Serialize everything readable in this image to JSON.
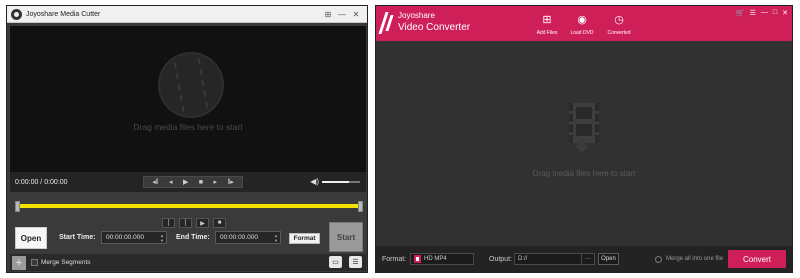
{
  "media_cutter": {
    "title": "Joyoshare Media Cutter",
    "window_controls": [
      "⊞",
      "—",
      "✕"
    ],
    "drag_hint": "Drag media files here to start",
    "time": "0:00:00 / 0:00:00",
    "playback_icons": [
      "◂‖",
      "◂",
      "▶",
      "■",
      "▸",
      "‖▸"
    ],
    "volume_level": 0.7,
    "segment_icons": [
      "[",
      "]",
      "▶",
      "■"
    ],
    "open_label": "Open",
    "start_time_label": "Start Time:",
    "start_time_value": "00:00:00.000",
    "end_time_label": "End Time:",
    "end_time_value": "00:00:00.000",
    "format_label": "Format",
    "start_label": "Start",
    "add_icon": "+",
    "merge_label": "Merge Segments",
    "bottom_icons": [
      "▭",
      "☰"
    ]
  },
  "video_converter": {
    "brand_line1": "Joyoshare",
    "brand_line2": "Video Converter",
    "toolbar": [
      {
        "icon": "⊞",
        "label": "Add Files"
      },
      {
        "icon": "◉",
        "label": "Load DVD"
      },
      {
        "icon": "◷",
        "label": "Converted"
      }
    ],
    "window_controls": [
      "🛒",
      "☰",
      "—",
      "□",
      "✕"
    ],
    "drop_hint": "Drag media files here to start",
    "format_label": "Format:",
    "format_value": "HD MP4",
    "output_label": "Output:",
    "output_value": "D://",
    "output_browse": "···",
    "open_label": "Open",
    "merge_label": "Merge all into one file",
    "convert_label": "Convert"
  }
}
